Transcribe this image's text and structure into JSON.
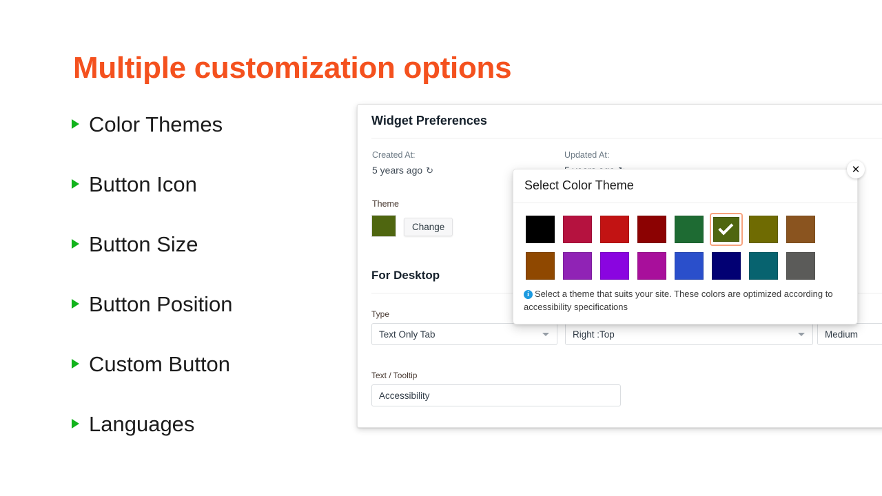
{
  "slide": {
    "title": "Multiple customization options",
    "title_color": "#F4511E",
    "bullet_color": "#11B31B",
    "bullets": [
      {
        "label": "Color Themes"
      },
      {
        "label": "Button Icon"
      },
      {
        "label": "Button Size"
      },
      {
        "label": "Button Position"
      },
      {
        "label": "Custom Button"
      },
      {
        "label": "Languages"
      }
    ]
  },
  "panel": {
    "title": "Widget Preferences",
    "created_label": "Created At:",
    "created_value": "5 years ago",
    "updated_label": "Updated At:",
    "updated_value": "5 years ago",
    "refresh_icon": "refresh-icon",
    "theme_label": "Theme",
    "theme_swatch_color": "#4f6610",
    "change_label": "Change",
    "section_title": "For Desktop",
    "fields": {
      "type": {
        "label": "Type",
        "value": "Text Only Tab"
      },
      "position": {
        "label": "",
        "value": "Right :Top"
      },
      "size": {
        "label": "",
        "value": "Medium"
      },
      "tooltip": {
        "label": "Text / Tooltip",
        "value": "Accessibility"
      }
    }
  },
  "modal": {
    "title": "Select Color Theme",
    "close_label": "✕",
    "note": "Select a theme that suits your site. These colors are optimized according to accessibility specifications",
    "info_icon_char": "i",
    "info_icon_color": "#1c9ae0",
    "selected_index": 5,
    "selected_border_color": "#f7a27e",
    "swatches": [
      {
        "name": "black",
        "hex": "#000000"
      },
      {
        "name": "crimson",
        "hex": "#B5123F"
      },
      {
        "name": "fire-red",
        "hex": "#C21313"
      },
      {
        "name": "dark-maroon",
        "hex": "#8C0202"
      },
      {
        "name": "forest-green",
        "hex": "#1E6B33"
      },
      {
        "name": "olive-green",
        "hex": "#4F6610"
      },
      {
        "name": "dark-olive",
        "hex": "#6F6B02"
      },
      {
        "name": "saddle-brown",
        "hex": "#8A541F"
      },
      {
        "name": "burnt-orange",
        "hex": "#8F4800"
      },
      {
        "name": "purple",
        "hex": "#9023B5"
      },
      {
        "name": "violet",
        "hex": "#8A05E0"
      },
      {
        "name": "magenta",
        "hex": "#A80F9B"
      },
      {
        "name": "royal-blue",
        "hex": "#2A4FCB"
      },
      {
        "name": "navy",
        "hex": "#020073"
      },
      {
        "name": "teal",
        "hex": "#07636F"
      },
      {
        "name": "gray",
        "hex": "#5B5B59"
      }
    ]
  }
}
